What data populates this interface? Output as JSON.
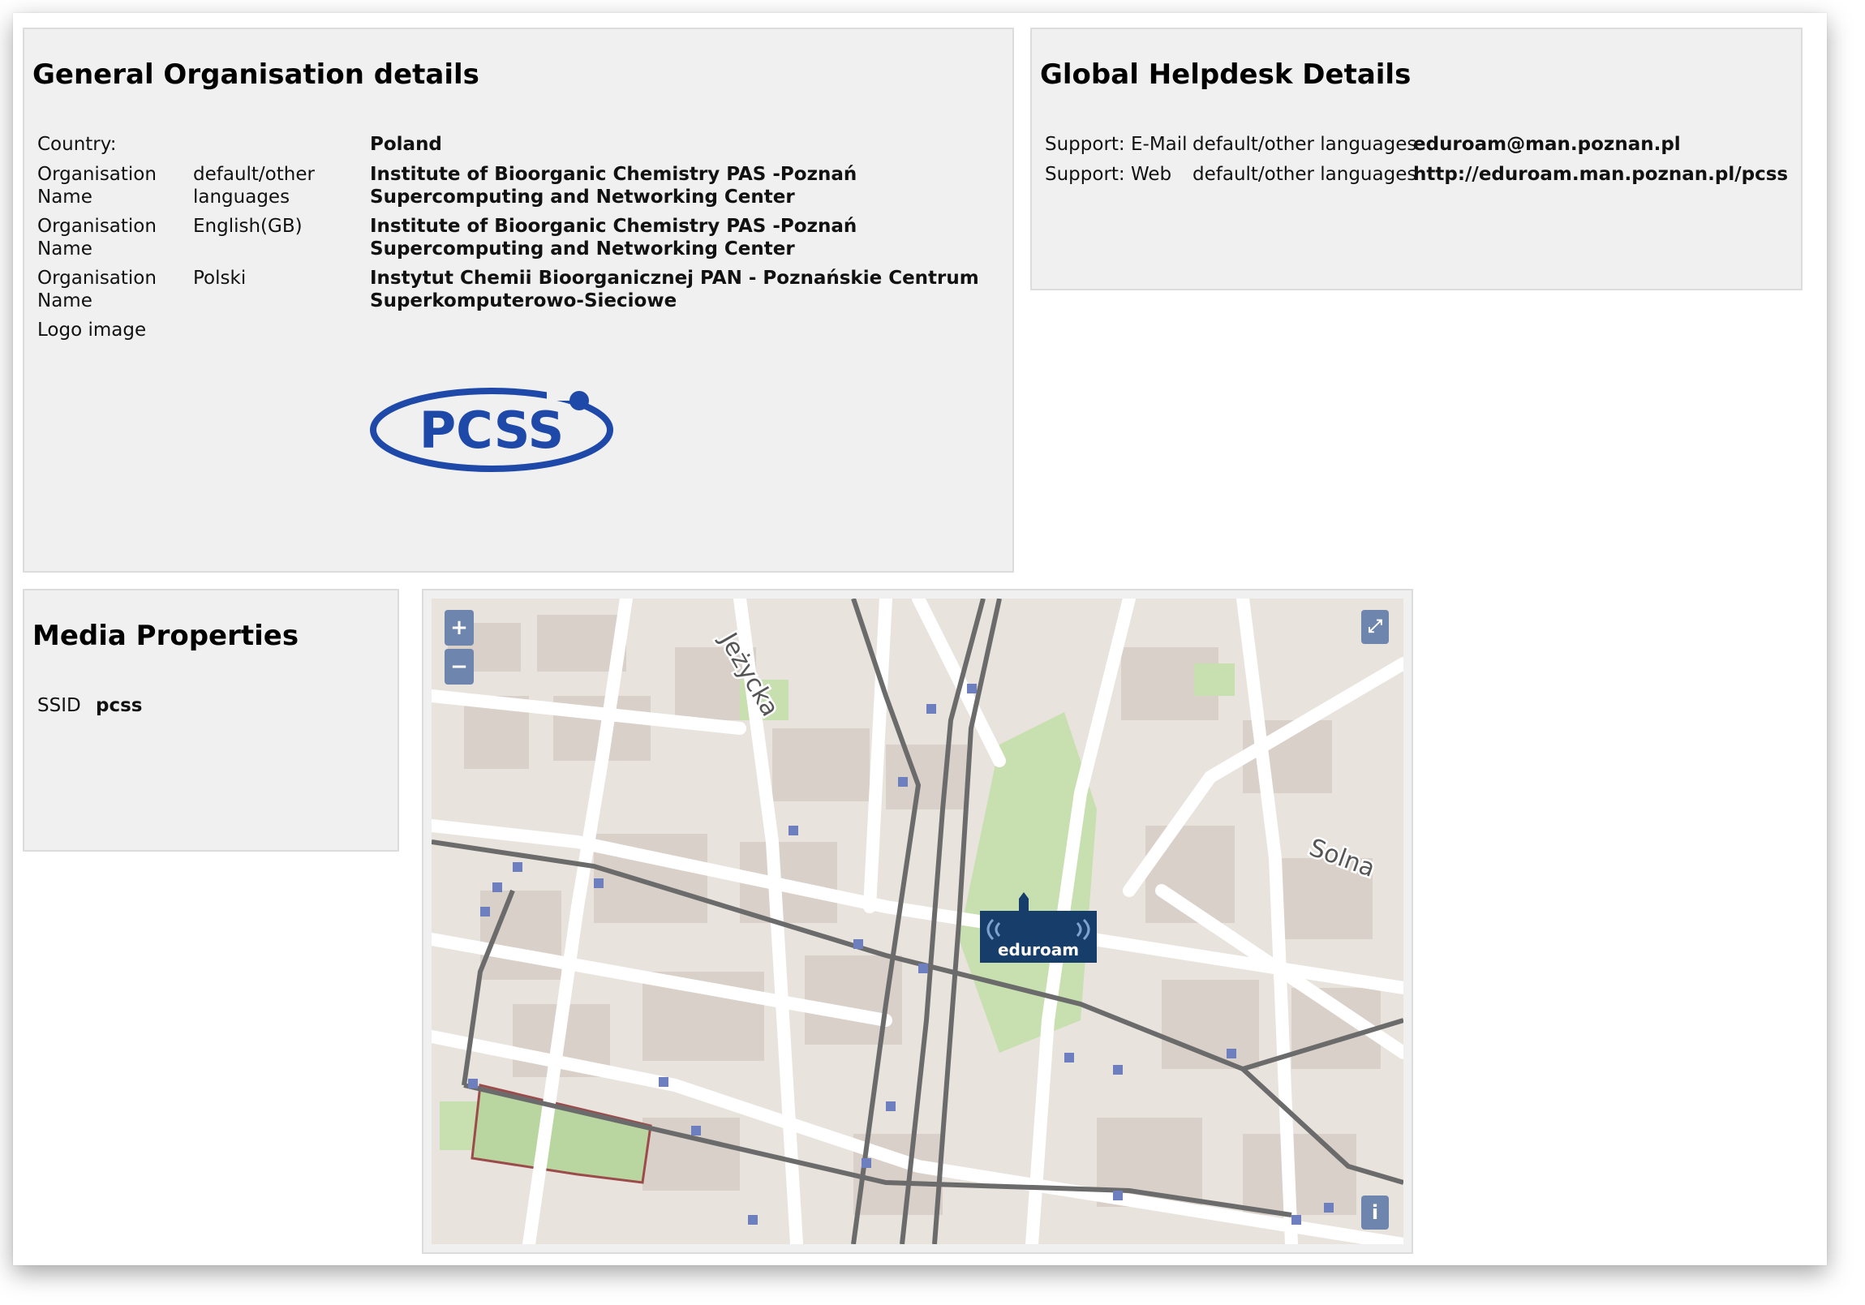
{
  "general": {
    "title": "General Organisation details",
    "country_label": "Country:",
    "country_value": "Poland",
    "names": [
      {
        "label": "Organisation Name",
        "lang": "default/other languages",
        "value": "Institute of Bioorganic Chemistry PAS -Poznań Supercomputing and Networking Center"
      },
      {
        "label": "Organisation Name",
        "lang": "English(GB)",
        "value": "Institute of Bioorganic Chemistry PAS -Poznań Supercomputing and Networking Center"
      },
      {
        "label": "Organisation Name",
        "lang": "Polski",
        "value": "Instytut Chemii Bioorganicznej PAN - Poznańskie Centrum Superkomputerowo-Sieciowe"
      }
    ],
    "logo_label": "Logo image",
    "logo_text": "PCSS",
    "logo_color": "#1f49a8"
  },
  "helpdesk": {
    "title": "Global Helpdesk Details",
    "rows": [
      {
        "label": "Support: E-Mail",
        "lang": "default/other languages",
        "value": "eduroam@man.poznan.pl"
      },
      {
        "label": "Support: Web",
        "lang": "default/other languages",
        "value": "http://eduroam.man.poznan.pl/pcss"
      }
    ]
  },
  "media": {
    "title": "Media Properties",
    "ssid_label": "SSID",
    "ssid_value": "pcss"
  },
  "map": {
    "zoom_in": "+",
    "zoom_out": "−",
    "fullscreen": "⤢",
    "info": "i",
    "street_labels": [
      "Jeżycka",
      "Solna"
    ],
    "marker_text": "eduroam",
    "marker_color": "#173d6b"
  }
}
